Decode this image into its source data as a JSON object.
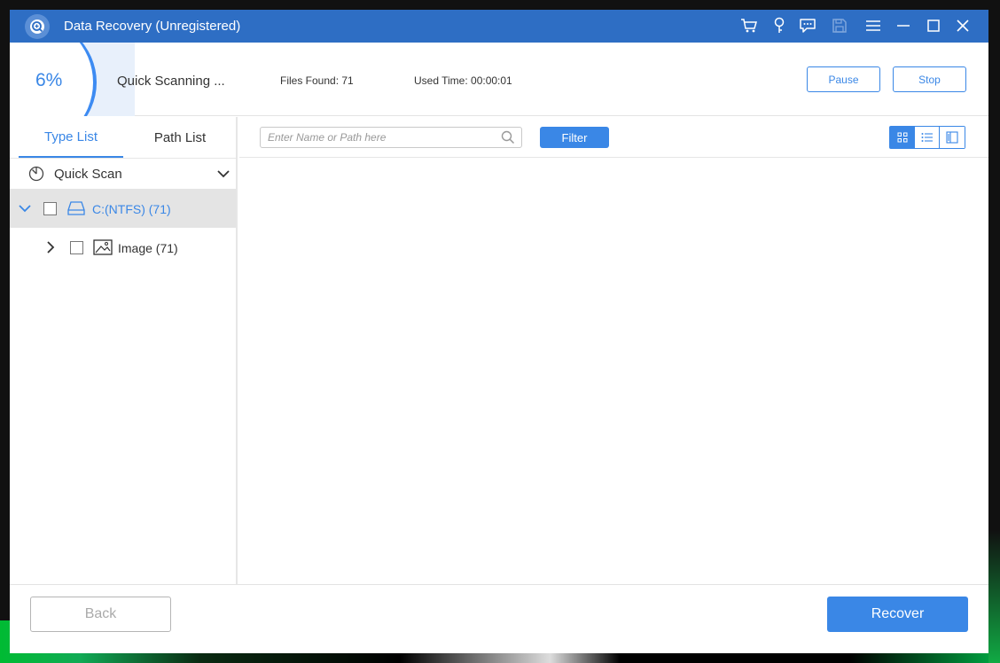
{
  "window": {
    "title": "Data Recovery (Unregistered)"
  },
  "titlebar_icons": [
    "cart-icon",
    "key-icon",
    "feedback-icon",
    "save-icon",
    "menu-icon",
    "minimize-icon",
    "maximize-icon",
    "close-icon"
  ],
  "scan": {
    "progress_percent": 6,
    "progress_label": "6%",
    "status": "Quick Scanning ...",
    "files_found": "Files Found: 71",
    "used_time": "Used Time: 00:00:01",
    "pause_label": "Pause",
    "stop_label": "Stop"
  },
  "sidebar": {
    "tabs": [
      {
        "label": "Type List",
        "active": true
      },
      {
        "label": "Path List",
        "active": false
      }
    ],
    "scan_mode": "Quick Scan",
    "tree": [
      {
        "label": "C:(NTFS) (71)",
        "expanded": true,
        "checked": false,
        "selected": true
      },
      {
        "label": "Image (71)",
        "expanded": false,
        "checked": false,
        "selected": false
      }
    ]
  },
  "toolbar": {
    "search_placeholder": "Enter Name or Path here",
    "filter_label": "Filter",
    "views": [
      "grid-view-icon",
      "list-view-icon",
      "preview-view-icon"
    ],
    "active_view": "grid-view-icon"
  },
  "footer": {
    "back_label": "Back",
    "recover_label": "Recover"
  },
  "colors": {
    "accent": "#3a87e6",
    "titlebar": "#2e6ec4",
    "selected_row": "#e4e4e4"
  }
}
